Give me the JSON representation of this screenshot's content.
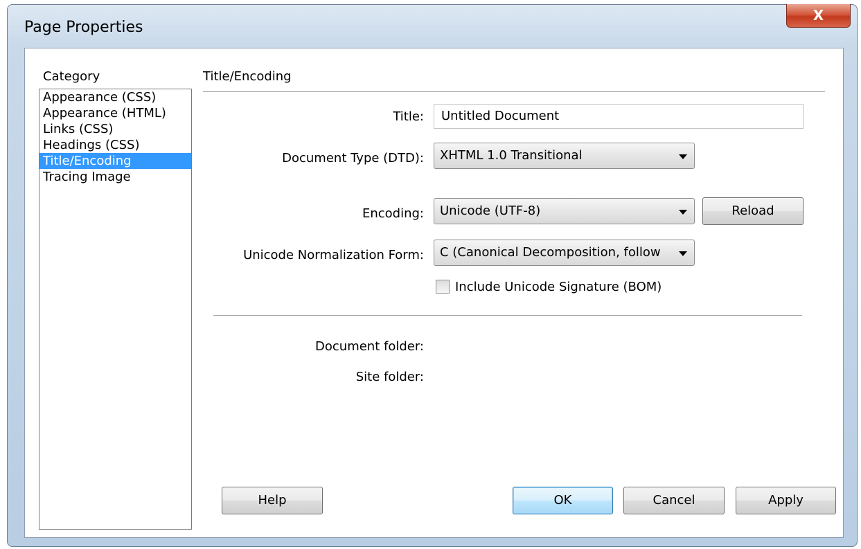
{
  "window": {
    "title": "Page Properties",
    "close_glyph": "X"
  },
  "category": {
    "heading": "Category",
    "items": [
      {
        "label": "Appearance (CSS)"
      },
      {
        "label": "Appearance (HTML)"
      },
      {
        "label": "Links (CSS)"
      },
      {
        "label": "Headings (CSS)"
      },
      {
        "label": "Title/Encoding",
        "selected": true
      },
      {
        "label": "Tracing Image"
      }
    ]
  },
  "panel": {
    "heading": "Title/Encoding",
    "title_label": "Title:",
    "title_value": "Untitled Document",
    "dtd_label": "Document Type (DTD):",
    "dtd_value": "XHTML 1.0 Transitional",
    "encoding_label": "Encoding:",
    "encoding_value": "Unicode (UTF-8)",
    "reload_label": "Reload",
    "normalization_label": "Unicode Normalization Form:",
    "normalization_value": "C (Canonical Decomposition, follow",
    "bom_label": "Include Unicode Signature (BOM)",
    "bom_checked": false,
    "doc_folder_label": "Document folder:",
    "site_folder_label": "Site folder:"
  },
  "buttons": {
    "help": "Help",
    "ok": "OK",
    "cancel": "Cancel",
    "apply": "Apply"
  },
  "colors": {
    "selection": "#3399ff",
    "close_button": "#c94a2f",
    "title_bar": "#c9d9ea"
  }
}
